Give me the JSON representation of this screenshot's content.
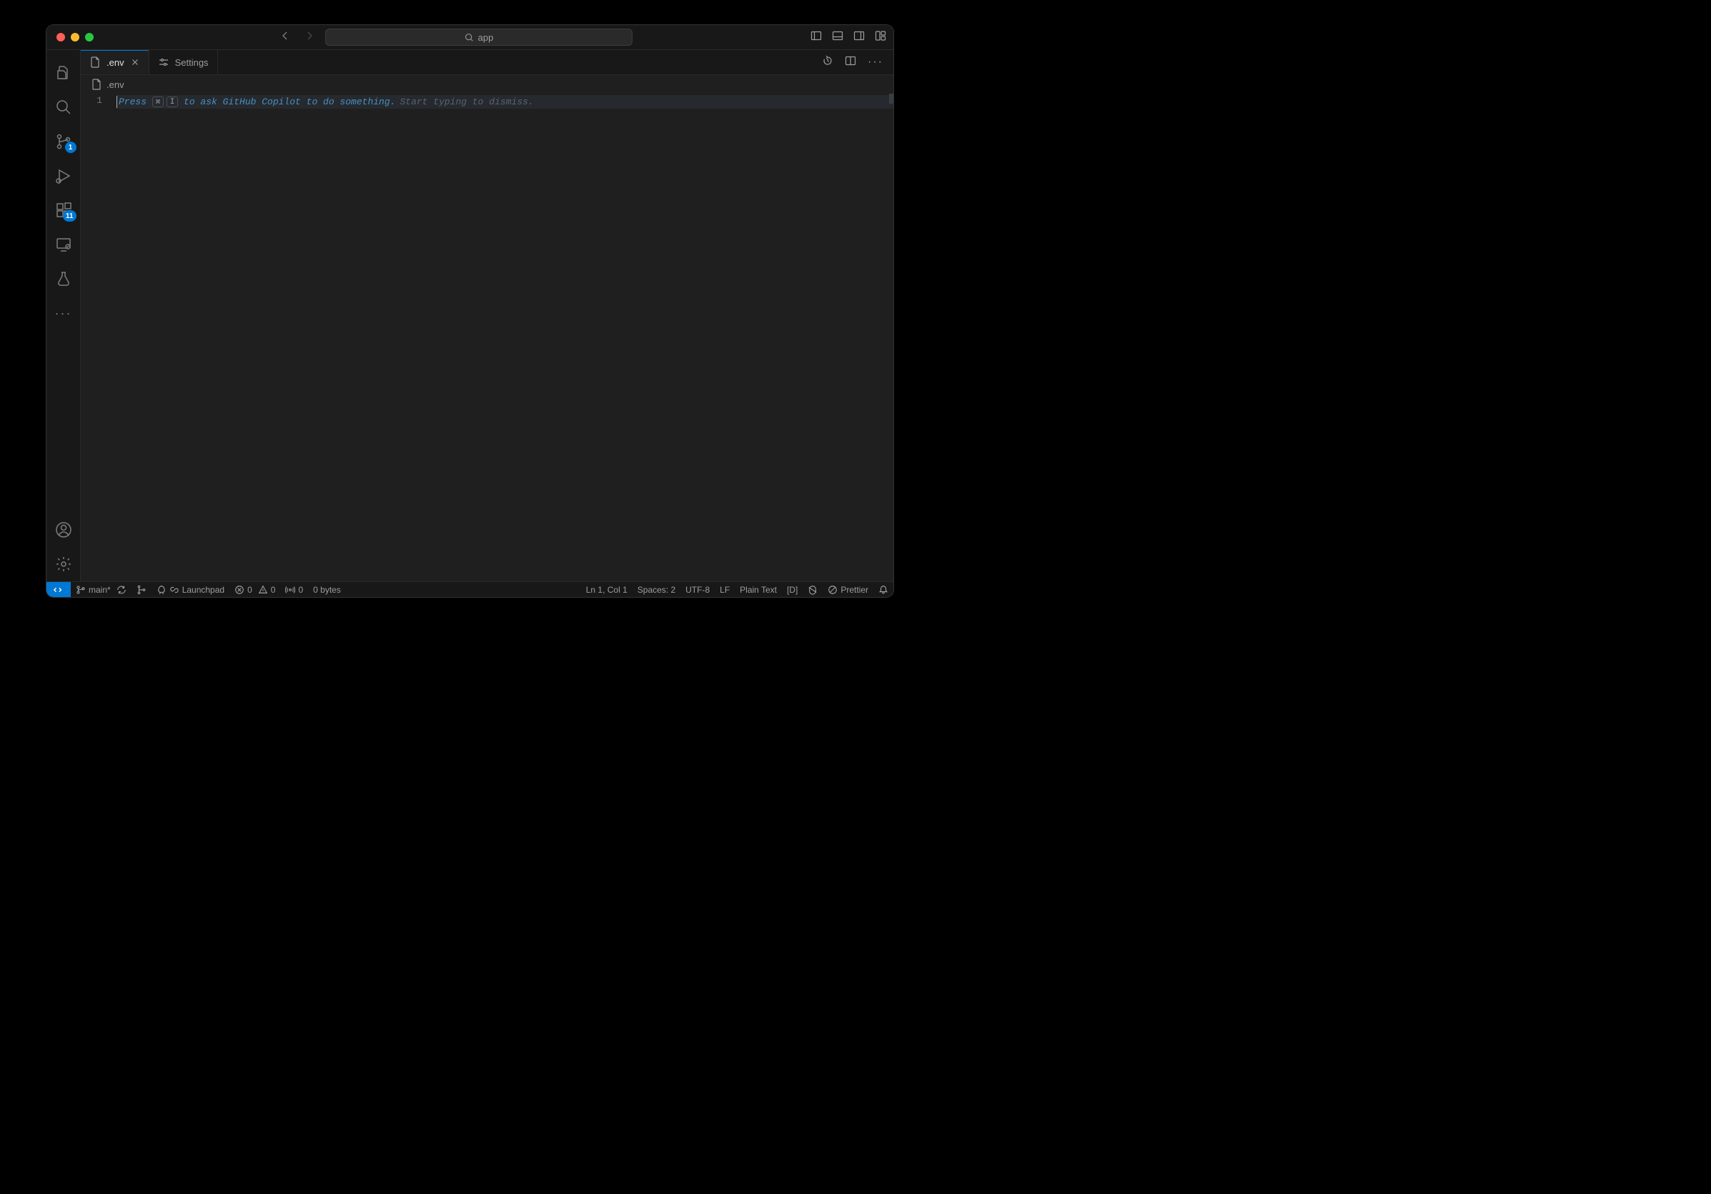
{
  "titlebar": {
    "command_center_text": "app"
  },
  "activitybar": {
    "scm_badge": "1",
    "extensions_badge": "11"
  },
  "tabs": [
    {
      "label": ".env",
      "active": true,
      "closable": true,
      "icon": "file"
    },
    {
      "label": "Settings",
      "active": false,
      "closable": false,
      "icon": "settings"
    }
  ],
  "breadcrumb": {
    "filename": ".env"
  },
  "editor": {
    "line_number": "1",
    "hint_press": "Press",
    "hint_key1": "⌘",
    "hint_key2": "I",
    "hint_rest": "to ask GitHub Copilot to do something.",
    "hint_dismiss": "Start typing to dismiss."
  },
  "statusbar": {
    "branch": "main*",
    "launchpad": "Launchpad",
    "errors": "0",
    "warnings": "0",
    "ports": "0",
    "bytes": "0 bytes",
    "cursor": "Ln 1, Col 1",
    "spaces": "Spaces: 2",
    "encoding": "UTF-8",
    "eol": "LF",
    "language": "Plain Text",
    "mode": "[D]",
    "prettier": "Prettier"
  }
}
